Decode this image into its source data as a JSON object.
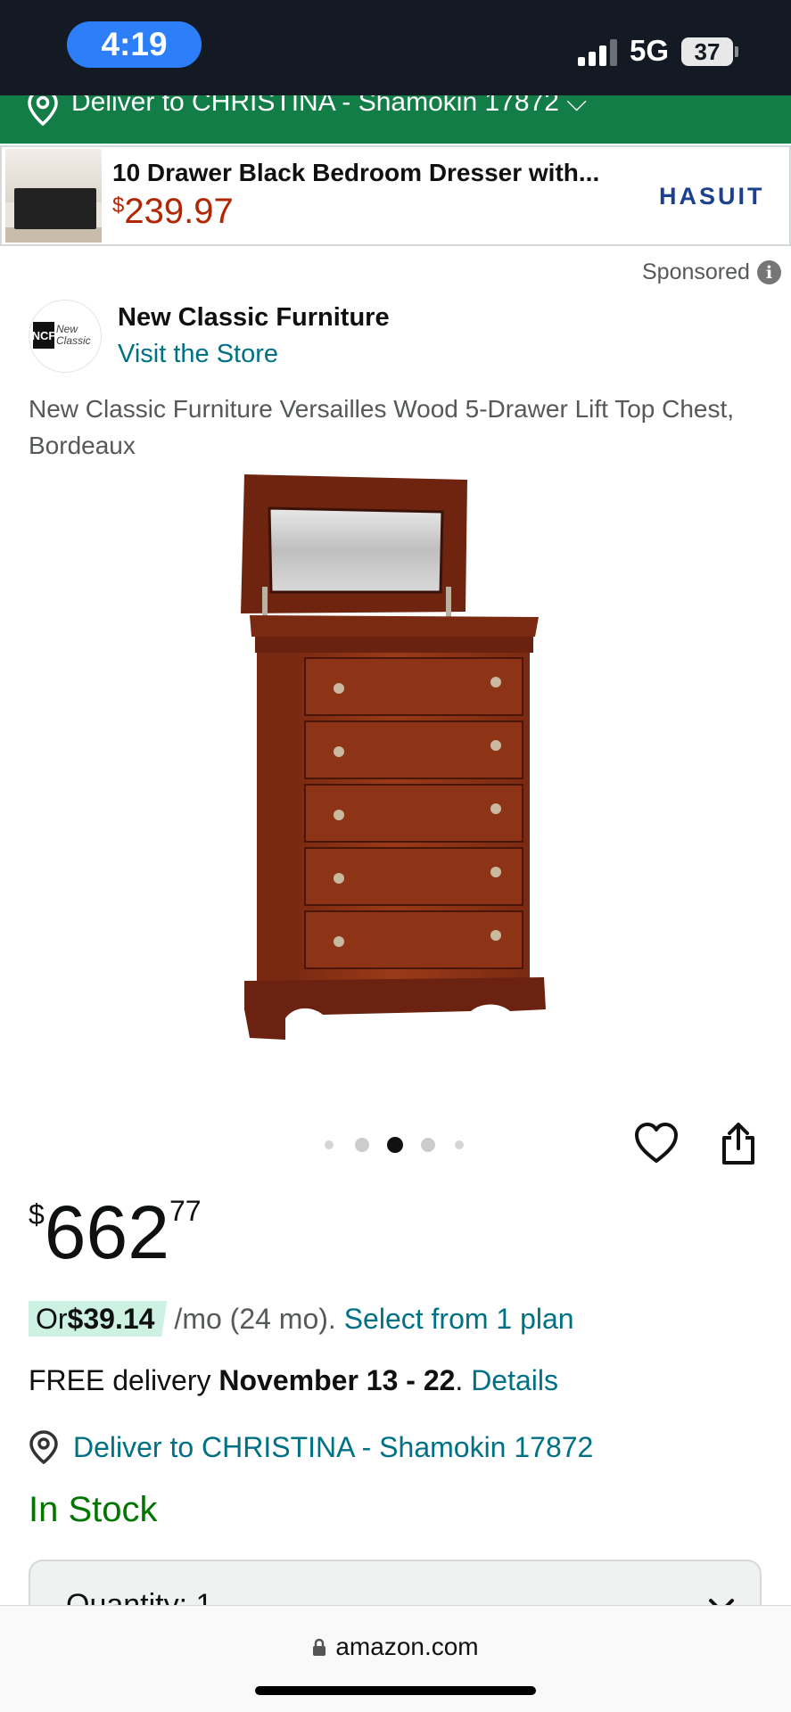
{
  "status_bar": {
    "time": "4:19",
    "network": "5G",
    "battery": "37"
  },
  "top_deliver": {
    "text": "Deliver to CHRISTINA - Shamokin 17872",
    "chevron": "⌵"
  },
  "ad": {
    "title": "10 Drawer Black Bedroom Dresser with...",
    "price_symbol": "$",
    "price": "239.97",
    "brand": "HASUIT",
    "sponsored_label": "Sponsored",
    "info_icon": "i"
  },
  "store": {
    "logo_mark": "NCF",
    "logo_word": "New Classic",
    "name": "New Classic Furniture",
    "link": "Visit the Store"
  },
  "product": {
    "title": "New Classic Furniture Versailles Wood 5-Drawer Lift Top Chest, Bordeaux",
    "carousel_total": 5,
    "carousel_active": 3,
    "price_symbol": "$",
    "price_whole": "662",
    "price_fraction": "77",
    "monthly_prefix": "Or ",
    "monthly_amount": "$39.14",
    "monthly_terms": "/mo (24 mo).",
    "plan_link": "Select from 1 plan",
    "delivery_prefix": "FREE delivery ",
    "delivery_dates": "November 13 - 22",
    "delivery_sep": ".",
    "details_link": "Details",
    "deliver_to": "Deliver to CHRISTINA - Shamokin 17872",
    "stock": "In Stock",
    "quantity_label": "Quantity: 1"
  },
  "browser": {
    "url": "amazon.com"
  },
  "icons": {
    "heart": "heart-icon",
    "share": "share-icon",
    "pin": "location-pin-icon",
    "lock": "lock-icon"
  },
  "colors": {
    "status_bar_bg": "#141a24",
    "time_pill": "#2d7ff9",
    "deliver_bar": "#137d47",
    "price_red": "#b12704",
    "link_teal": "#007185",
    "in_stock_green": "#007600",
    "monthly_pill": "#cdf2e3",
    "wood": "#8b2e12"
  }
}
